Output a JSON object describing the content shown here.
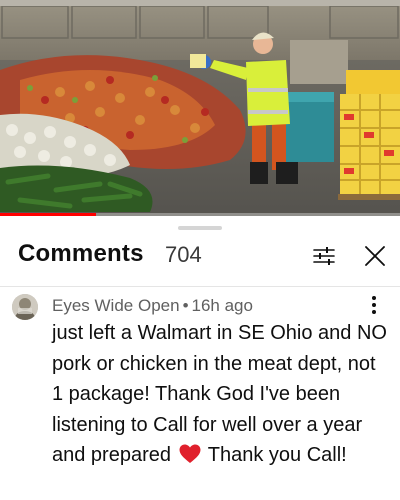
{
  "video": {
    "scene": "food-waste-dump-video-frame",
    "progress_fraction": 0.24,
    "progress_color": "#ff0000"
  },
  "comments_panel": {
    "title": "Comments",
    "count": "704",
    "filter_icon": "sliders-icon",
    "close_icon": "close-icon"
  },
  "comment": {
    "author": "Eyes Wide Open",
    "separator": "•",
    "time": "16h ago",
    "text_before_emoji": "just left a Walmart in SE Ohio and NO pork or chicken in the meat dept, not 1 package! Thank God I've been listening to Call for well over a year and prepared",
    "emoji": "red-heart-icon",
    "text_after_emoji": "Thank you Call!",
    "menu_icon": "more-vert-icon"
  },
  "colors": {
    "text_primary": "#0f0f0f",
    "text_secondary": "#606060",
    "heart": "#e0202c"
  }
}
